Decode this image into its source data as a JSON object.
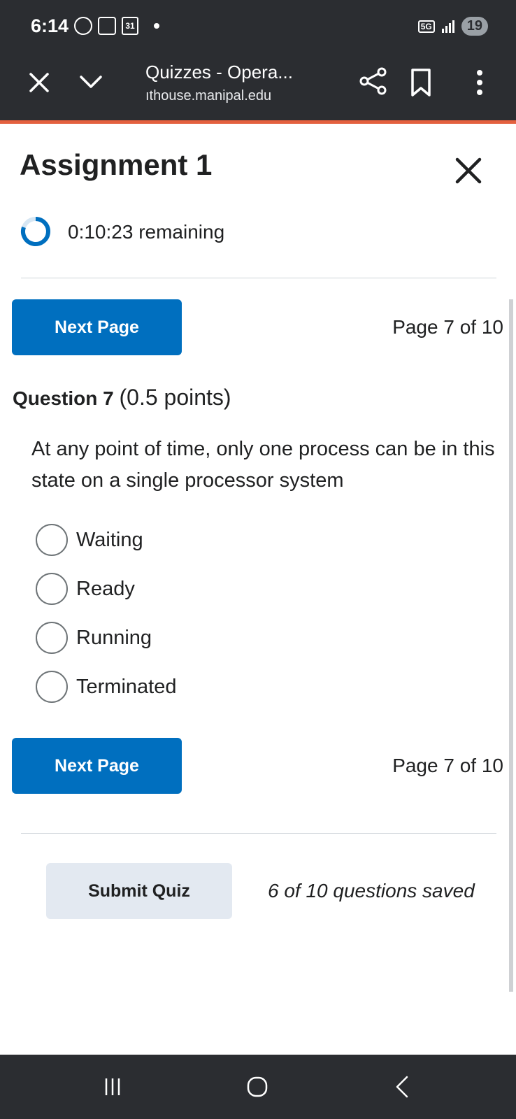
{
  "status_bar": {
    "time": "6:14",
    "calendar_day": "31",
    "network": "5G",
    "battery": "19",
    "icons": [
      "whatsapp-icon",
      "screenshot-icon",
      "calendar-icon",
      "notification-dot",
      "network-5g-icon",
      "signal-icon",
      "battery-icon"
    ]
  },
  "browser": {
    "title": "Quizzes - Opera...",
    "url": "ıthouse.manipal.edu",
    "accent_color": "#e4603f",
    "icons": [
      "close-icon",
      "chevron-down-icon",
      "share-icon",
      "bookmark-icon",
      "more-vert-icon"
    ]
  },
  "quiz": {
    "title": "Assignment 1",
    "timer": "0:10:23 remaining",
    "next_page_label": "Next Page",
    "page_indicator": "Page 7 of 10",
    "question": {
      "number_label": "Question 7",
      "points_label": "(0.5 points)",
      "text": "At any point of time, only one process can be in this state on a single processor system",
      "options": [
        "Waiting",
        "Ready",
        "Running",
        "Terminated"
      ]
    },
    "submit_label": "Submit Quiz",
    "saved_status": "6 of 10 questions saved",
    "primary_color": "#006fbf"
  },
  "nav_bar": {
    "icons": [
      "recents-icon",
      "home-icon",
      "back-icon"
    ]
  }
}
